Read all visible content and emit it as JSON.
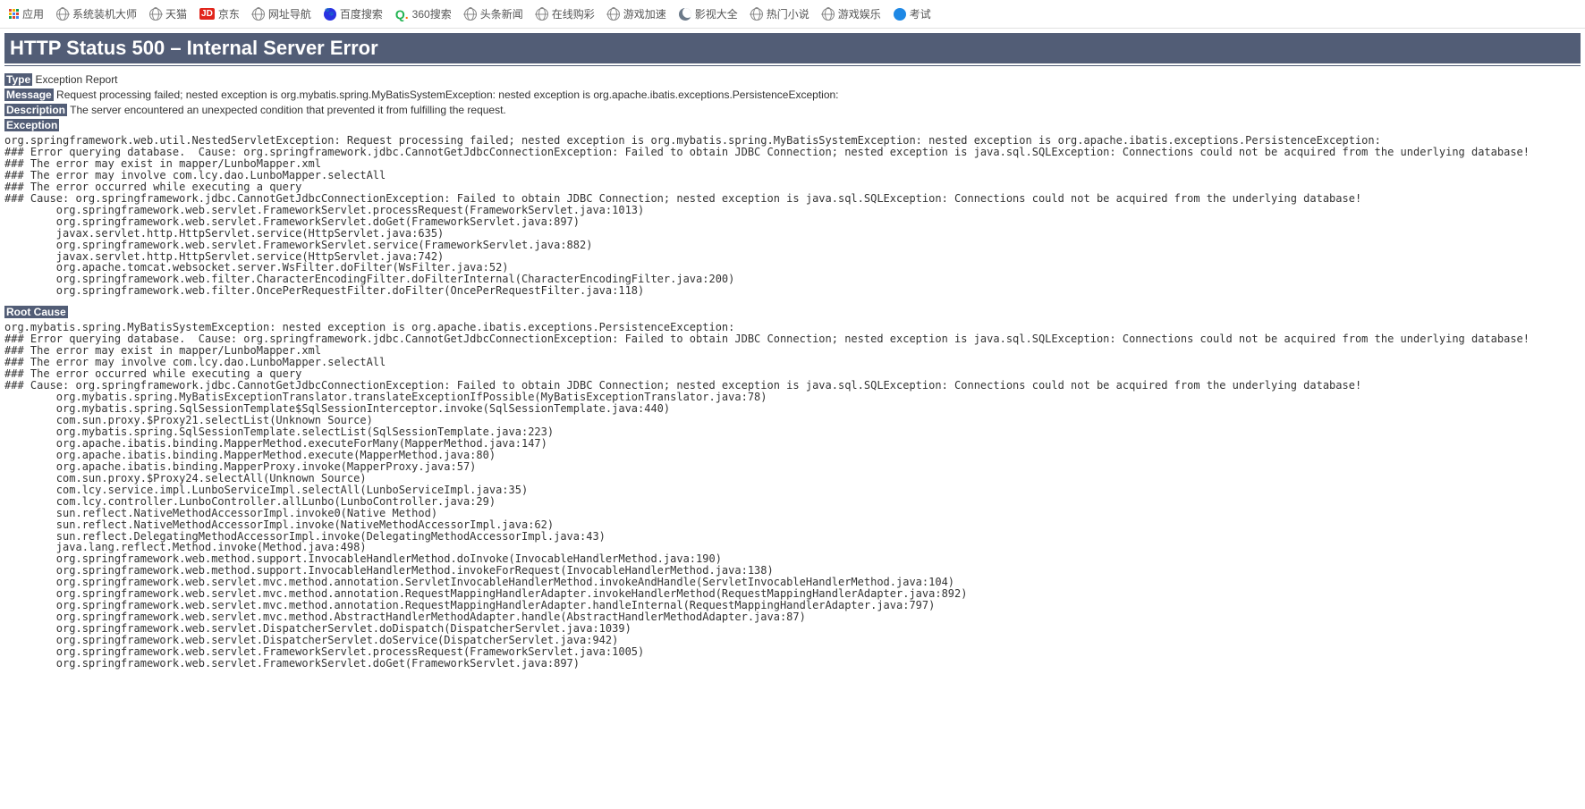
{
  "bookmarks": [
    {
      "icon": "apps",
      "label": "应用"
    },
    {
      "icon": "globe",
      "label": "系统装机大师"
    },
    {
      "icon": "globe",
      "label": "天猫"
    },
    {
      "icon": "jd",
      "label": "京东"
    },
    {
      "icon": "globe",
      "label": "网址导航"
    },
    {
      "icon": "paw",
      "label": "百度搜索"
    },
    {
      "icon": "q360",
      "label": "360搜索"
    },
    {
      "icon": "globe",
      "label": "头条新闻"
    },
    {
      "icon": "globe",
      "label": "在线购彩"
    },
    {
      "icon": "globe",
      "label": "游戏加速"
    },
    {
      "icon": "crescent",
      "label": "影视大全"
    },
    {
      "icon": "globe",
      "label": "热门小说"
    },
    {
      "icon": "globe",
      "label": "游戏娱乐"
    },
    {
      "icon": "bluecircle",
      "label": "考试"
    }
  ],
  "error": {
    "title": "HTTP Status 500 – Internal Server Error",
    "type_label": "Type",
    "type_value": "Exception Report",
    "message_label": "Message",
    "message_value": "Request processing failed; nested exception is org.mybatis.spring.MyBatisSystemException: nested exception is org.apache.ibatis.exceptions.PersistenceException:",
    "description_label": "Description",
    "description_value": "The server encountered an unexpected condition that prevented it from fulfilling the request.",
    "exception_label": "Exception",
    "exception_stack": "org.springframework.web.util.NestedServletException: Request processing failed; nested exception is org.mybatis.spring.MyBatisSystemException: nested exception is org.apache.ibatis.exceptions.PersistenceException: \n### Error querying database.  Cause: org.springframework.jdbc.CannotGetJdbcConnectionException: Failed to obtain JDBC Connection; nested exception is java.sql.SQLException: Connections could not be acquired from the underlying database!\n### The error may exist in mapper/LunboMapper.xml\n### The error may involve com.lcy.dao.LunboMapper.selectAll\n### The error occurred while executing a query\n### Cause: org.springframework.jdbc.CannotGetJdbcConnectionException: Failed to obtain JDBC Connection; nested exception is java.sql.SQLException: Connections could not be acquired from the underlying database!\n\torg.springframework.web.servlet.FrameworkServlet.processRequest(FrameworkServlet.java:1013)\n\torg.springframework.web.servlet.FrameworkServlet.doGet(FrameworkServlet.java:897)\n\tjavax.servlet.http.HttpServlet.service(HttpServlet.java:635)\n\torg.springframework.web.servlet.FrameworkServlet.service(FrameworkServlet.java:882)\n\tjavax.servlet.http.HttpServlet.service(HttpServlet.java:742)\n\torg.apache.tomcat.websocket.server.WsFilter.doFilter(WsFilter.java:52)\n\torg.springframework.web.filter.CharacterEncodingFilter.doFilterInternal(CharacterEncodingFilter.java:200)\n\torg.springframework.web.filter.OncePerRequestFilter.doFilter(OncePerRequestFilter.java:118)",
    "rootcause_label": "Root Cause",
    "rootcause_stack": "org.mybatis.spring.MyBatisSystemException: nested exception is org.apache.ibatis.exceptions.PersistenceException: \n### Error querying database.  Cause: org.springframework.jdbc.CannotGetJdbcConnectionException: Failed to obtain JDBC Connection; nested exception is java.sql.SQLException: Connections could not be acquired from the underlying database!\n### The error may exist in mapper/LunboMapper.xml\n### The error may involve com.lcy.dao.LunboMapper.selectAll\n### The error occurred while executing a query\n### Cause: org.springframework.jdbc.CannotGetJdbcConnectionException: Failed to obtain JDBC Connection; nested exception is java.sql.SQLException: Connections could not be acquired from the underlying database!\n\torg.mybatis.spring.MyBatisExceptionTranslator.translateExceptionIfPossible(MyBatisExceptionTranslator.java:78)\n\torg.mybatis.spring.SqlSessionTemplate$SqlSessionInterceptor.invoke(SqlSessionTemplate.java:440)\n\tcom.sun.proxy.$Proxy21.selectList(Unknown Source)\n\torg.mybatis.spring.SqlSessionTemplate.selectList(SqlSessionTemplate.java:223)\n\torg.apache.ibatis.binding.MapperMethod.executeForMany(MapperMethod.java:147)\n\torg.apache.ibatis.binding.MapperMethod.execute(MapperMethod.java:80)\n\torg.apache.ibatis.binding.MapperProxy.invoke(MapperProxy.java:57)\n\tcom.sun.proxy.$Proxy24.selectAll(Unknown Source)\n\tcom.lcy.service.impl.LunboServiceImpl.selectAll(LunboServiceImpl.java:35)\n\tcom.lcy.controller.LunboController.allLunbo(LunboController.java:29)\n\tsun.reflect.NativeMethodAccessorImpl.invoke0(Native Method)\n\tsun.reflect.NativeMethodAccessorImpl.invoke(NativeMethodAccessorImpl.java:62)\n\tsun.reflect.DelegatingMethodAccessorImpl.invoke(DelegatingMethodAccessorImpl.java:43)\n\tjava.lang.reflect.Method.invoke(Method.java:498)\n\torg.springframework.web.method.support.InvocableHandlerMethod.doInvoke(InvocableHandlerMethod.java:190)\n\torg.springframework.web.method.support.InvocableHandlerMethod.invokeForRequest(InvocableHandlerMethod.java:138)\n\torg.springframework.web.servlet.mvc.method.annotation.ServletInvocableHandlerMethod.invokeAndHandle(ServletInvocableHandlerMethod.java:104)\n\torg.springframework.web.servlet.mvc.method.annotation.RequestMappingHandlerAdapter.invokeHandlerMethod(RequestMappingHandlerAdapter.java:892)\n\torg.springframework.web.servlet.mvc.method.annotation.RequestMappingHandlerAdapter.handleInternal(RequestMappingHandlerAdapter.java:797)\n\torg.springframework.web.servlet.mvc.method.AbstractHandlerMethodAdapter.handle(AbstractHandlerMethodAdapter.java:87)\n\torg.springframework.web.servlet.DispatcherServlet.doDispatch(DispatcherServlet.java:1039)\n\torg.springframework.web.servlet.DispatcherServlet.doService(DispatcherServlet.java:942)\n\torg.springframework.web.servlet.FrameworkServlet.processRequest(FrameworkServlet.java:1005)\n\torg.springframework.web.servlet.FrameworkServlet.doGet(FrameworkServlet.java:897)"
  }
}
